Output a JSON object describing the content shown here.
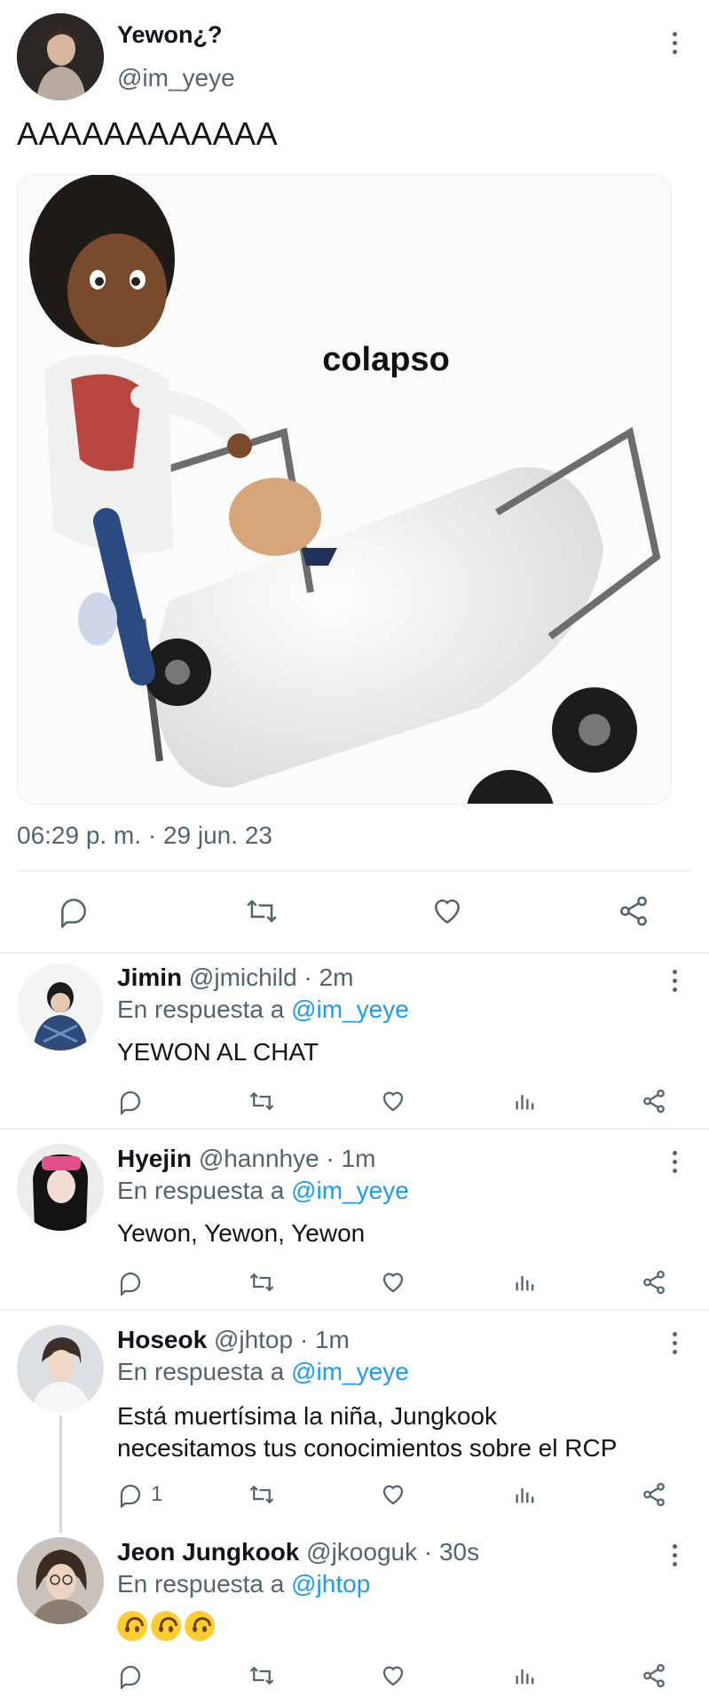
{
  "main_tweet": {
    "display_name": "Yewon¿?",
    "handle": "@im_yeye",
    "text": "AAAAAAAAAAAA",
    "image_caption": "colapso",
    "timestamp": "06:29 p. m. · 29 jun. 23"
  },
  "replies": [
    {
      "name": "Jimin",
      "handle": "@jmichild",
      "time": "· 2m",
      "reply_prefix": "En respuesta a",
      "reply_to": "@im_yeye",
      "text": "YEWON AL CHAT",
      "reply_count": ""
    },
    {
      "name": "Hyejin",
      "handle": "@hannhye",
      "time": "· 1m",
      "reply_prefix": "En respuesta a",
      "reply_to": "@im_yeye",
      "text": "Yewon, Yewon, Yewon",
      "reply_count": ""
    },
    {
      "name": "Hoseok",
      "handle": "@jhtop",
      "time": "· 1m",
      "reply_prefix": "En respuesta a",
      "reply_to": "@im_yeye",
      "text_line1": "Está muertísima la niña, Jungkook",
      "text_line2": "necesitamos tus conocimientos sobre el RCP",
      "reply_count": "1"
    },
    {
      "name": "Jeon Jungkook",
      "handle": "@jkooguk",
      "time": "· 30s",
      "reply_prefix": "En respuesta a",
      "reply_to": "@jhtop",
      "emoji": "upside-down-face x3"
    }
  ],
  "colors": {
    "text": "#0f1419",
    "secondary": "#536471",
    "accent": "#1d9bf0",
    "divider": "#e6e9ec"
  }
}
